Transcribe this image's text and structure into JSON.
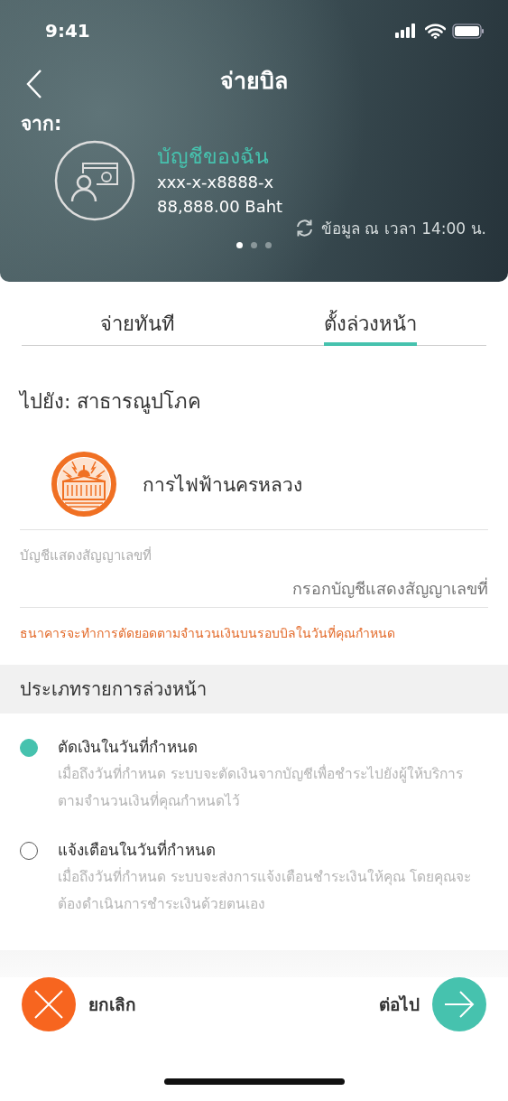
{
  "status_bar": {
    "time": "9:41"
  },
  "header": {
    "title": "จ่ายบิล",
    "from_label": "จาก:",
    "account": {
      "name": "บัญชีของฉัน",
      "number": "xxx-x-x8888-x",
      "balance": "88,888.00 Baht"
    },
    "updated": "ข้อมูล ณ เวลา 14:00 น.",
    "pages": [
      {
        "selected": true
      },
      {
        "selected": false
      },
      {
        "selected": false
      }
    ]
  },
  "tabs": [
    {
      "label": "จ่ายทันที",
      "selected": false
    },
    {
      "label": "ตั้งล่วงหน้า",
      "selected": true
    }
  ],
  "destination": "ไปยัง: สาธารณูปโภค",
  "biller": {
    "name": "การไฟฟ้านครหลวง"
  },
  "contract_field": {
    "label": "บัญชีแสดงสัญญาเลขที่",
    "placeholder": "กรอกบัญชีแสดงสัญญาเลขที่"
  },
  "note": "ธนาคารจะทำการตัดยอดตามจำนวนเงินบนรอบบิลในวันที่คุณกำหนด",
  "schedule_section": {
    "title": "ประเภทรายการล่วงหน้า",
    "options": [
      {
        "title": "ตัดเงินในวันที่กำหนด",
        "description": "เมื่อถึงวันที่กำหนด ระบบจะตัดเงินจากบัญชีเพื่อชำระไปยังผู้ให้บริการ ตามจำนวนเงินที่คุณกำหนดไว้",
        "selected": true
      },
      {
        "title": "แจ้งเตือนในวันที่กำหนด",
        "description": "เมื่อถึงวันที่กำหนด ระบบจะส่งการแจ้งเตือนชำระเงินให้คุณ โดยคุณจะต้องดำเนินการชำระเงินด้วยตนเอง",
        "selected": false
      }
    ]
  },
  "actions": {
    "cancel": "ยกเลิก",
    "next": "ต่อไป"
  }
}
